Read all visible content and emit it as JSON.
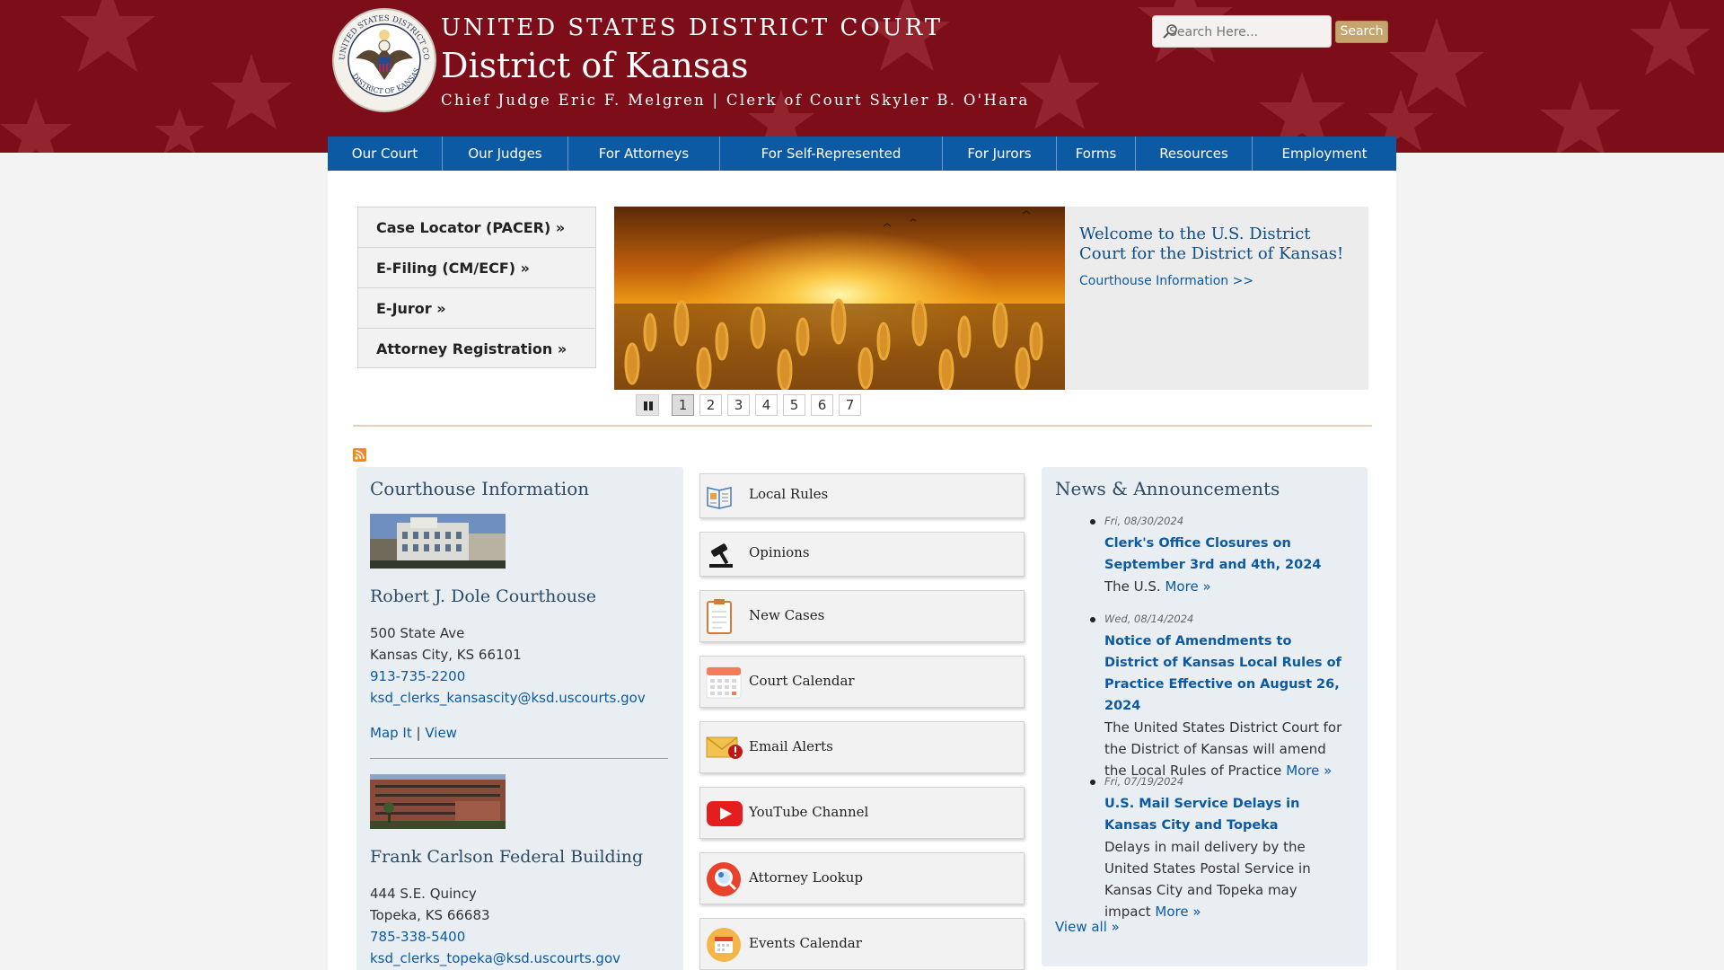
{
  "header": {
    "court_name": "UNITED STATES DISTRICT COURT",
    "district": "District of Kansas",
    "officials": "Chief Judge Eric F. Melgren | Clerk of Court Skyler B. O'Hara",
    "seal_text": "UNITED STATES DISTRICT COURT · DISTRICT OF KANSAS"
  },
  "search": {
    "placeholder": "Search Here...",
    "button_label": "Search"
  },
  "nav": {
    "items": [
      "Our Court",
      "Our Judges",
      "For Attorneys",
      "For Self-Represented",
      "For Jurors",
      "Forms",
      "Resources",
      "Employment"
    ]
  },
  "quicklinks": [
    "Case Locator (PACER) »",
    "E-Filing (CM/ECF) »",
    "E-Juror »",
    "Attorney Registration »"
  ],
  "slideshow": {
    "title": "Welcome to the U.S. District Court for the District of Kansas!",
    "link": "Courthouse Information >>",
    "pages": [
      "1",
      "2",
      "3",
      "4",
      "5",
      "6",
      "7"
    ],
    "active_page": "1"
  },
  "courthouse": {
    "heading": "Courthouse Information",
    "locations": [
      {
        "name": "Robert J. Dole Courthouse",
        "address1": "500 State Ave",
        "address2": "Kansas City, KS 66101",
        "phone": "913-735-2200",
        "email": "ksd_clerks_kansascity@ksd.uscourts.gov",
        "map_link": "Map It",
        "separator": "|",
        "view_link": "View"
      },
      {
        "name": "Frank Carlson Federal Building",
        "address1": "444 S.E. Quincy",
        "address2": "Topeka, KS 66683",
        "phone": "785-338-5400",
        "email": "ksd_clerks_topeka@ksd.uscourts.gov"
      }
    ]
  },
  "tiles": [
    {
      "label": "Local Rules",
      "icon": "book-icon"
    },
    {
      "label": "Opinions",
      "icon": "gavel-icon"
    },
    {
      "label": "New Cases",
      "icon": "clipboard-icon"
    },
    {
      "label": "Court Calendar",
      "icon": "calendar-icon"
    },
    {
      "label": "Email Alerts",
      "icon": "envelope-alert-icon"
    },
    {
      "label": "YouTube Channel",
      "icon": "youtube-icon"
    },
    {
      "label": "Attorney Lookup",
      "icon": "magnifier-icon"
    },
    {
      "label": "Events Calendar",
      "icon": "event-calendar-icon"
    }
  ],
  "news": {
    "heading": "News & Announcements",
    "items": [
      {
        "date": "Fri, 08/30/2024",
        "title": "Clerk's Office Closures on September 3rd and 4th, 2024",
        "body": "The U.S.",
        "more": "More »"
      },
      {
        "date": "Wed, 08/14/2024",
        "title": "Notice of Amendments to District of Kansas Local Rules of Practice Effective on August 26, 2024",
        "body": "The United States District Court for the District of Kansas will amend the Local Rules of Practice",
        "more": "More »"
      },
      {
        "date": "Fri, 07/19/2024",
        "title": "U.S. Mail Service Delays in Kansas City and Topeka",
        "body": "Delays in mail delivery by the United States Postal Service in Kansas City and Topeka may impact",
        "more": "More »"
      }
    ],
    "view_all": "View all »"
  },
  "colors": {
    "header_red": "#7d0e19",
    "nav_blue": "#0b5aa3",
    "link_blue": "#0b5aa3",
    "search_button": "#c6a46d",
    "panel_bg": "#e9eef3"
  }
}
